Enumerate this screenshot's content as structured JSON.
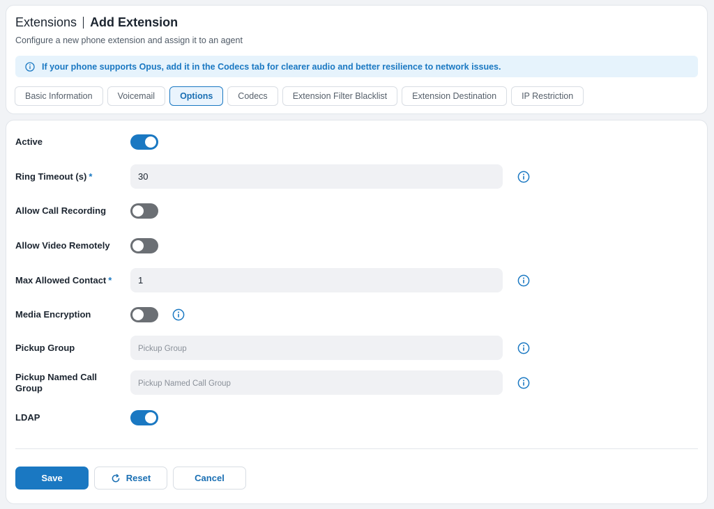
{
  "header": {
    "section": "Extensions",
    "page_title": "Add Extension",
    "subtitle": "Configure a new phone extension and assign it to an agent"
  },
  "notice": {
    "text": "If your phone supports Opus, add it in the Codecs tab for clearer audio and better resilience to network issues.",
    "icon": "info-circle-icon"
  },
  "tabs": [
    {
      "label": "Basic Information",
      "active": false
    },
    {
      "label": "Voicemail",
      "active": false
    },
    {
      "label": "Options",
      "active": true
    },
    {
      "label": "Codecs",
      "active": false
    },
    {
      "label": "Extension Filter Blacklist",
      "active": false
    },
    {
      "label": "Extension Destination",
      "active": false
    },
    {
      "label": "IP Restriction",
      "active": false
    }
  ],
  "form": {
    "active": {
      "label": "Active",
      "enabled": true
    },
    "ring_timeout": {
      "label": "Ring Timeout (s)",
      "required_mark": "*",
      "value": "30"
    },
    "allow_call_recording": {
      "label": "Allow Call Recording",
      "enabled": false
    },
    "allow_video_remotely": {
      "label": "Allow Video Remotely",
      "enabled": false
    },
    "max_allowed_contact": {
      "label": "Max Allowed Contact",
      "required_mark": "*",
      "value": "1"
    },
    "media_encryption": {
      "label": "Media Encryption",
      "enabled": false
    },
    "pickup_group": {
      "label": "Pickup Group",
      "placeholder": "Pickup Group",
      "value": ""
    },
    "pickup_named_call_group": {
      "label": "Pickup Named Call Group",
      "placeholder": "Pickup Named Call Group",
      "value": ""
    },
    "ldap": {
      "label": "LDAP",
      "enabled": true
    }
  },
  "actions": {
    "save_label": "Save",
    "reset_label": "Reset",
    "cancel_label": "Cancel"
  },
  "colors": {
    "accent": "#1a78c2",
    "toggle_off": "#6b6f74",
    "notice_bg": "#e6f3fc",
    "input_bg": "#f0f1f4"
  }
}
